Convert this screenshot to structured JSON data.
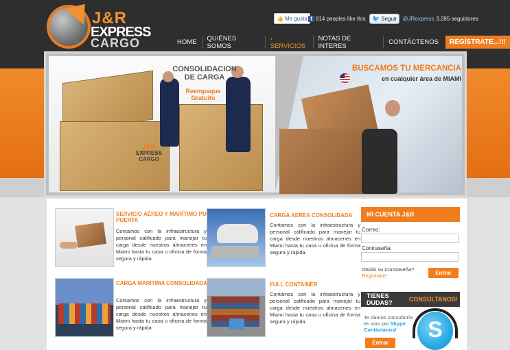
{
  "logo": {
    "line1": "J&R",
    "line2": "EXPRESS",
    "line3": "CARGO"
  },
  "social": {
    "like_label": "Me gusta",
    "fb_text": "814 peoples like this.",
    "follow_label": "Seguir",
    "twitter_handle": "@JRexpress",
    "followers": "3.285 seguidores"
  },
  "nav": {
    "items": [
      "HOME",
      "QUIÉNES SOMOS",
      "› SERVICIOS",
      "NOTAS DE INTERES",
      "CONTÁCTENOS"
    ],
    "register": "REGÍSTRATE...!!!"
  },
  "banner": {
    "consolidacion": "CONSOLIDACION DE CARGA",
    "reempaque": "Reempaque Gratuito",
    "crate_logo": [
      "J&R",
      "EXPRESS",
      "CARGO"
    ],
    "buscamos": "BUSCAMOS TU MERCANCIA",
    "miami": "en cualquier área de MIAMI"
  },
  "services": [
    {
      "title": "SERVICIO AÉREO Y MARÍTIMO PUERTA PUERTA",
      "text": "Contamos con la infraestructura y personal calificado para manejar tu carga desde nuestros almacenes en Miami hasta tu casa u oficina de forma segura y rápida."
    },
    {
      "title": "CARGA AEREA CONSOLIDADA",
      "text": "Contamos con la infraestructura y personal calificado para manejar tu carga desde nuestros almacenes en Miami hasta tu casa u oficina de forma segura y rápida."
    },
    {
      "title": "CARGA MARITIMA CONSOLIDADA",
      "text": "Contamos con la infraestructura y personal calificado para manejar tu carga desde nuestros almacenes en Miami hasta tu casa u oficina de forma segura y rápida."
    },
    {
      "title": "FULL CONTAINER",
      "text": "Contamos con la infraestructura y personal calificado para manejar tu carga desde nuestros almacenes en Miami hasta tu casa u oficina de forma segura y rápida."
    }
  ],
  "account": {
    "title": "MI CUENTA  J&R",
    "email_label": "Correo:",
    "password_label": "Contraseña:",
    "forgot": "Olvido su Contraseña?",
    "register": "Regístrate!",
    "button": "Entrar"
  },
  "skype": {
    "title_a": "TIENES DUDAS?",
    "title_b": "CONSÚLTANOS!",
    "text": "Te damos consultoría en vivo por",
    "brand": "Skype",
    "cta": "Contáctanos!",
    "button": "Entrar"
  },
  "colors": {
    "accent": "#f07e1f",
    "dark": "#2e2e2e"
  },
  "icons": [
    "facebook-like-icon",
    "facebook-icon",
    "twitter-bird-icon",
    "us-flag-icon",
    "skype-icon"
  ]
}
